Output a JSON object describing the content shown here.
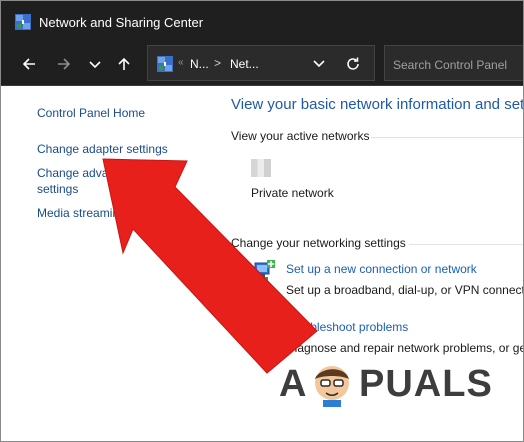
{
  "window": {
    "title": "Network and Sharing Center"
  },
  "toolbar": {
    "back_icon": "back-arrow-icon",
    "forward_icon": "forward-arrow-icon",
    "recent_icon": "chevron-down-icon",
    "up_icon": "up-arrow-icon",
    "address": {
      "collapsed_marker": "«",
      "segments": [
        "N...",
        "Net..."
      ],
      "separator": ">"
    },
    "refresh_icon": "refresh-icon",
    "search_placeholder": "Search Control Panel"
  },
  "left_pane": {
    "home_link": "Control Panel Home",
    "adapter_link": "Change adapter settings",
    "sharing_link_line1": "Change advanced sharing",
    "sharing_link_line2": "settings",
    "media_link": "Media streaming options"
  },
  "main": {
    "title": "View your basic network information and set up connections",
    "active_networks_label": "View your active networks",
    "active_network": {
      "type": "Private network"
    },
    "change_settings_label": "Change your networking settings",
    "tasks": [
      {
        "link": "Set up a new connection or network",
        "desc": "Set up a broadband, dial-up, or VPN connection; or set up a router or access point."
      },
      {
        "link": "Troubleshoot problems",
        "desc": "Diagnose and repair network problems, or get troubleshooting information."
      }
    ]
  },
  "overlay": {
    "arrow_color": "#e8201c",
    "watermark": {
      "left": "A",
      "right": "PUALS"
    }
  },
  "colors": {
    "titlebar": "#1f1f1f",
    "link": "#1a4c8a",
    "heading": "#1e5aa8"
  }
}
